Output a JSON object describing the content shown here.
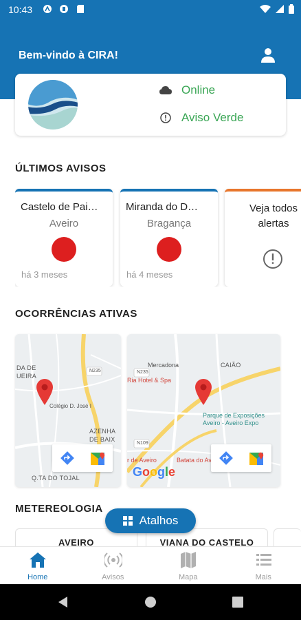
{
  "status_bar": {
    "time": "10:43"
  },
  "header": {
    "welcome": "Bem-vindo à CIRA!"
  },
  "status_card": {
    "connection": "Online",
    "warning_level": "Aviso Verde",
    "accent_color": "#3aa655"
  },
  "sections": {
    "alerts_title": "ÚLTIMOS AVISOS",
    "occurrences_title": "OCORRÊNCIAS ATIVAS",
    "meteo_title": "METEREOLOGIA"
  },
  "alerts": [
    {
      "name": "Castelo de Pai…",
      "region": "Aveiro",
      "time": "há 3 meses",
      "status_color": "#dd1f1f"
    },
    {
      "name": "Miranda do D…",
      "region": "Bragança",
      "time": "há 4 meses",
      "status_color": "#dd1f1f"
    }
  ],
  "see_all": {
    "line1": "Veja todos",
    "line2": "alertas"
  },
  "maps": [
    {
      "labels": [
        "DA DE",
        "UEIRA",
        "AZENHA",
        "DE BAIX",
        "Q.TA DO TOJAL"
      ],
      "poi": "Colégio D. José I",
      "road": "N235"
    },
    {
      "labels": [
        "CAIÃO"
      ],
      "pois": [
        "Mercadona",
        "Ria Hotel & Spa",
        "Parque de Exposições Aveiro - Aveiro Expo",
        "r de Aveiro",
        "Batata do Aveiro"
      ],
      "roads": [
        "N235",
        "N109"
      ],
      "attribution": "Google"
    }
  ],
  "meteo": [
    {
      "city": "AVEIRO"
    },
    {
      "city": "VIANA DO CASTELO"
    }
  ],
  "fab": {
    "label": "Atalhos"
  },
  "bottom_nav": [
    {
      "label": "Home",
      "icon": "home-icon",
      "active": true
    },
    {
      "label": "Avisos",
      "icon": "broadcast-icon",
      "active": false
    },
    {
      "label": "Mapa",
      "icon": "map-icon",
      "active": false
    },
    {
      "label": "Mais",
      "icon": "menu-list-icon",
      "active": false
    }
  ],
  "colors": {
    "primary": "#1673b4",
    "alert_orange": "#e8762c"
  }
}
